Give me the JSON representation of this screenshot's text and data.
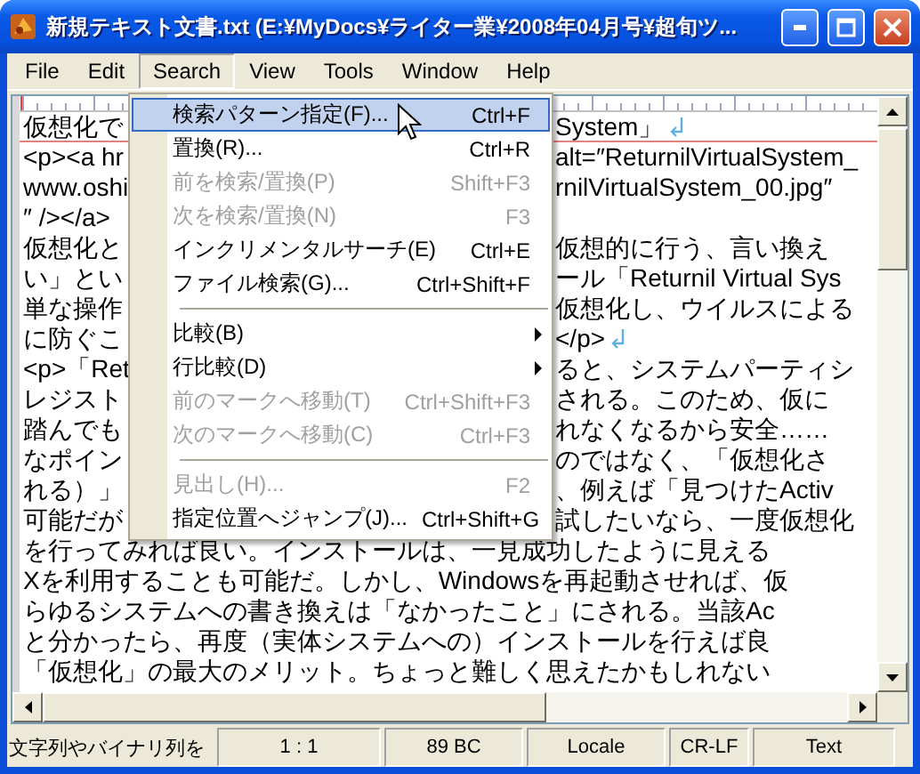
{
  "window": {
    "title": "新規テキスト文書.txt (E:¥MyDocs¥ライター業¥2008年04月号¥超旬ツ..."
  },
  "menu_bar": [
    {
      "label": "File",
      "selected": false
    },
    {
      "label": "Edit",
      "selected": false
    },
    {
      "label": "Search",
      "selected": true
    },
    {
      "label": "View",
      "selected": false
    },
    {
      "label": "Tools",
      "selected": false
    },
    {
      "label": "Window",
      "selected": false
    },
    {
      "label": "Help",
      "selected": false
    }
  ],
  "editor": {
    "lines": [
      {
        "left": "仮想化で",
        "right": "System」",
        "eol": true,
        "current": true
      },
      {
        "left": "<p><a hr",
        "right": "alt=″ReturnilVirtualSystem_",
        "eol": false,
        "current": false
      },
      {
        "left": "www.oshi",
        "right": "rnilVirtualSystem_00.jpg″",
        "eol": false,
        "current": false
      },
      {
        "left": "″ /></a>",
        "eol": false,
        "current": false
      },
      {
        "left": "仮想化と",
        "right": "仮想的に行う、言い換え",
        "eol": false,
        "current": false
      },
      {
        "left": "い」とい",
        "right": "ール「Returnil Virtual Sys",
        "eol": false,
        "current": false
      },
      {
        "left": "単な操作",
        "right": "仮想化し、ウイルスによる",
        "eol": false,
        "current": false
      },
      {
        "left": "に防ぐこ",
        "right": "</p>",
        "eol": true,
        "current": false
      },
      {
        "left": "<p>「Ret",
        "right": "ると、システムパーティシ",
        "eol": false,
        "current": false
      },
      {
        "left": "レジスト",
        "right": "される。このため、仮に",
        "eol": false,
        "current": false
      },
      {
        "left": "踏んでも",
        "right": "れなくなるから安全……",
        "eol": false,
        "current": false
      },
      {
        "left": "なポイン",
        "right": "のではなく、「仮想化さ",
        "eol": false,
        "current": false
      },
      {
        "left": "れる）」",
        "right": "、例えば「見つけたActiv",
        "eol": false,
        "current": false
      },
      {
        "left": "可能だが",
        "right": "試したいなら、一度仮想化",
        "eol": false,
        "current": false
      },
      {
        "full": "を行ってみれば良い。インストールは、一見成功したように見える",
        "eol": false,
        "current": false
      },
      {
        "full": "Xを利用することも可能だ。しかし、Windowsを再起動させれば、仮",
        "eol": false,
        "current": false
      },
      {
        "full": "らゆるシステムへの書き換えは「なかったこと」にされる。当該Ac",
        "eol": false,
        "current": false
      },
      {
        "full": "と分かったら、再度（実体システムへの）インストールを行えば良",
        "eol": false,
        "current": false
      },
      {
        "full": "「仮想化」の最大のメリット。ちょっと難しく思えたかもしれない",
        "eol": false,
        "current": false
      }
    ]
  },
  "search_menu": [
    {
      "kind": "item",
      "label": "検索パターン指定(F)...",
      "shortcut": "Ctrl+F",
      "disabled": false,
      "selected": true,
      "submenu": false
    },
    {
      "kind": "item",
      "label": "置換(R)...",
      "shortcut": "Ctrl+R",
      "disabled": false,
      "selected": false,
      "submenu": false
    },
    {
      "kind": "item",
      "label": "前を検索/置換(P)",
      "shortcut": "Shift+F3",
      "disabled": true,
      "selected": false,
      "submenu": false
    },
    {
      "kind": "item",
      "label": "次を検索/置換(N)",
      "shortcut": "F3",
      "disabled": true,
      "selected": false,
      "submenu": false
    },
    {
      "kind": "item",
      "label": "インクリメンタルサーチ(E)",
      "shortcut": "Ctrl+E",
      "disabled": false,
      "selected": false,
      "submenu": false
    },
    {
      "kind": "item",
      "label": "ファイル検索(G)...",
      "shortcut": "Ctrl+Shift+F",
      "disabled": false,
      "selected": false,
      "submenu": false
    },
    {
      "kind": "separator"
    },
    {
      "kind": "item",
      "label": "比較(B)",
      "disabled": false,
      "selected": false,
      "submenu": true
    },
    {
      "kind": "item",
      "label": "行比較(D)",
      "disabled": false,
      "selected": false,
      "submenu": true
    },
    {
      "kind": "item",
      "label": "前のマークへ移動(T)",
      "shortcut": "Ctrl+Shift+F3",
      "disabled": true,
      "selected": false,
      "submenu": false
    },
    {
      "kind": "item",
      "label": "次のマークへ移動(C)",
      "shortcut": "Ctrl+F3",
      "disabled": true,
      "selected": false,
      "submenu": false
    },
    {
      "kind": "separator"
    },
    {
      "kind": "item",
      "label": "見出し(H)...",
      "shortcut": "F2",
      "disabled": true,
      "selected": false,
      "submenu": false
    },
    {
      "kind": "item",
      "label": "指定位置へジャンプ(J)...",
      "shortcut": "Ctrl+Shift+G",
      "disabled": false,
      "selected": false,
      "submenu": false
    }
  ],
  "status_bar": [
    "文字列やバイナリ列を",
    "1 : 1",
    "89 BC",
    "Locale",
    "CR-LF",
    "Text"
  ]
}
